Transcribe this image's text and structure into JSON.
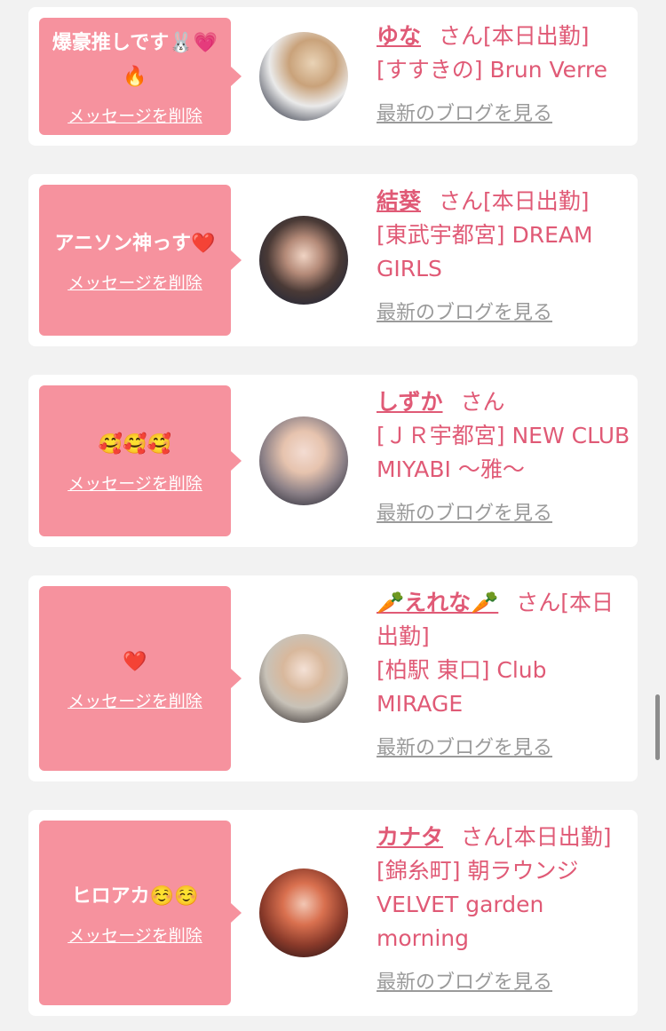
{
  "entries": [
    {
      "message": "爆豪推しです🐰💗🔥",
      "delete_label": "メッセージを削除",
      "name": "ゆな",
      "san": "さん[本日出勤]",
      "shop": "[すすきの] Brun Verre",
      "blog_label": "最新のブログを見る"
    },
    {
      "message": "アニソン神っす❤️",
      "delete_label": "メッセージを削除",
      "name": "結葵",
      "san": "さん[本日出勤]",
      "shop": "[東武宇都宮] DREAM GIRLS",
      "blog_label": "最新のブログを見る"
    },
    {
      "message": "🥰🥰🥰",
      "delete_label": "メッセージを削除",
      "name": "しずか",
      "san": "さん",
      "shop": "[ＪＲ宇都宮] NEW CLUB MIYABI ～雅～",
      "blog_label": "最新のブログを見る"
    },
    {
      "message": "❤️",
      "delete_label": "メッセージを削除",
      "name": "🥕えれな🥕",
      "san": "さん[本日出勤]",
      "shop": "[柏駅 東口] Club MIRAGE",
      "blog_label": "最新のブログを見る"
    },
    {
      "message": "ヒロアカ☺️☺️",
      "delete_label": "メッセージを削除",
      "name": "カナタ",
      "san": "さん[本日出勤]",
      "shop": "[錦糸町] 朝ラウンジ VELVET garden morning",
      "blog_label": "最新のブログを見る"
    }
  ],
  "colors": {
    "bubble": "#f6929e",
    "accent_text": "#e05a76",
    "link_gray": "#9a9a9a",
    "background": "#f2f2f2"
  }
}
